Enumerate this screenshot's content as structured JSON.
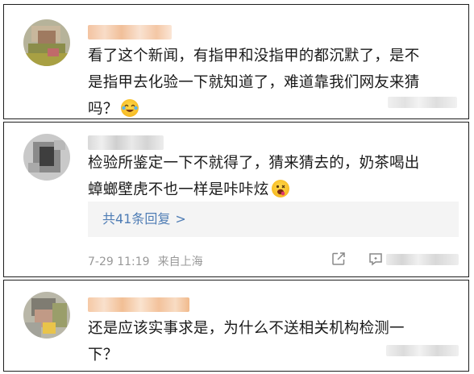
{
  "comments": [
    {
      "text_lines": [
        "看了这个新闻，有指甲和没指甲的都沉默了，是不",
        "是指甲去化验一下就知道了，难道靠我们网友来猜",
        "吗？"
      ],
      "emoji": "laughing-crying-emoji"
    },
    {
      "text_lines": [
        "检验所鉴定一下不就得了，猜来猜去的，奶茶喝出",
        "蟑螂壁虎不也一样是咔咔炫"
      ],
      "emoji": "drooling-emoji",
      "replies_label": "共41条回复",
      "replies_chevron": ">",
      "time": "7-29 11:19",
      "location": "来自上海",
      "icons": [
        "share-icon",
        "comment-icon"
      ]
    },
    {
      "text_lines": [
        "还是应该实事求是，为什么不送相关机构检测一",
        "下？"
      ]
    }
  ],
  "colors": {
    "link": "#4f7db5",
    "meta": "#999999",
    "reply_bg": "#f4f4f4",
    "card_border": "#1e1e1e"
  }
}
